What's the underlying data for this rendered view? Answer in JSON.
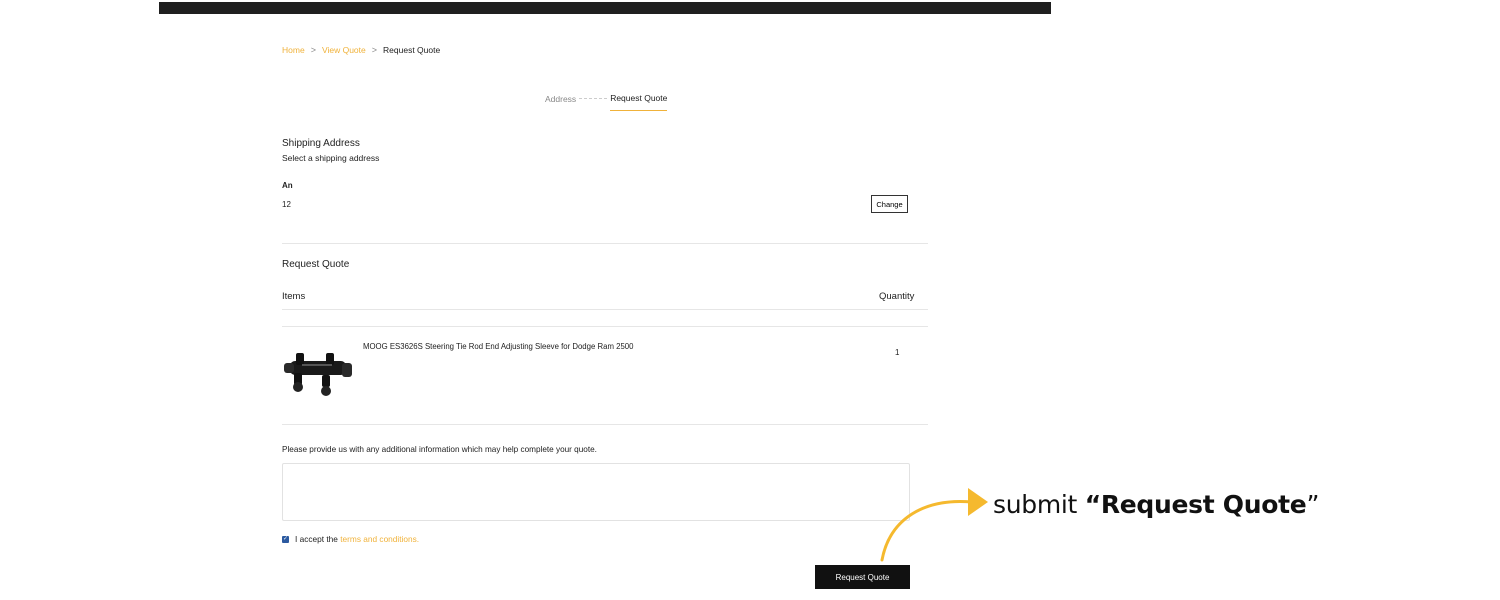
{
  "breadcrumb": {
    "home": "Home",
    "view_quote": "View Quote",
    "current": "Request Quote",
    "separator": ">"
  },
  "steps": {
    "address": "Address",
    "request_quote": "Request Quote"
  },
  "shipping": {
    "title": "Shipping Address",
    "subtitle": "Select a shipping address",
    "name": "An",
    "line1": "12",
    "change_label": "Change"
  },
  "quote": {
    "title": "Request Quote",
    "items_header": "Items",
    "quantity_header": "Quantity",
    "items": [
      {
        "name": "MOOG ES3626S Steering Tie Rod End Adjusting Sleeve for Dodge Ram 2500",
        "quantity": "1"
      }
    ]
  },
  "additional_info": {
    "label": "Please provide us with any additional information which may help complete your quote.",
    "value": ""
  },
  "terms": {
    "prefix": "I accept the",
    "link": "terms and conditions.",
    "checked": true
  },
  "submit_label": "Request Quote",
  "annotation": {
    "prefix": "submit ",
    "emphasis": "“Request Quote",
    "suffix": "”"
  },
  "colors": {
    "accent": "#f0b23a",
    "button": "#111111",
    "checkbox": "#2c5aa0"
  }
}
